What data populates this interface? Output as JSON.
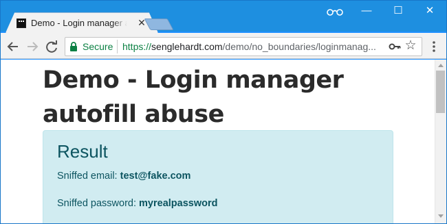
{
  "tab": {
    "title": "Demo - Login manager autofill abuse",
    "close_label": "✕"
  },
  "window_controls": {
    "minimize": "—",
    "maximize": "☐",
    "close": "✕"
  },
  "toolbar": {
    "icons": [
      "back-arrow-icon",
      "forward-arrow-icon",
      "reload-icon",
      "lock-icon",
      "key-icon",
      "star-icon",
      "menu-icon"
    ],
    "secure_label": "Secure",
    "url_scheme": "https://",
    "url_host": "senglehardt.com",
    "url_path": "/demo/no_boundaries/loginmanag..."
  },
  "page": {
    "title": "Demo - Login manager autofill abuse",
    "result": {
      "heading": "Result",
      "email_label": "Sniffed email: ",
      "email_value": "test@fake.com",
      "password_label": "Sniffed password: ",
      "password_value": "myrealpassword"
    }
  },
  "colors": {
    "frame": "#1e8fe0",
    "secure_green": "#0b8043",
    "alert_bg": "#d1ecf1",
    "alert_text": "#0c5460"
  }
}
